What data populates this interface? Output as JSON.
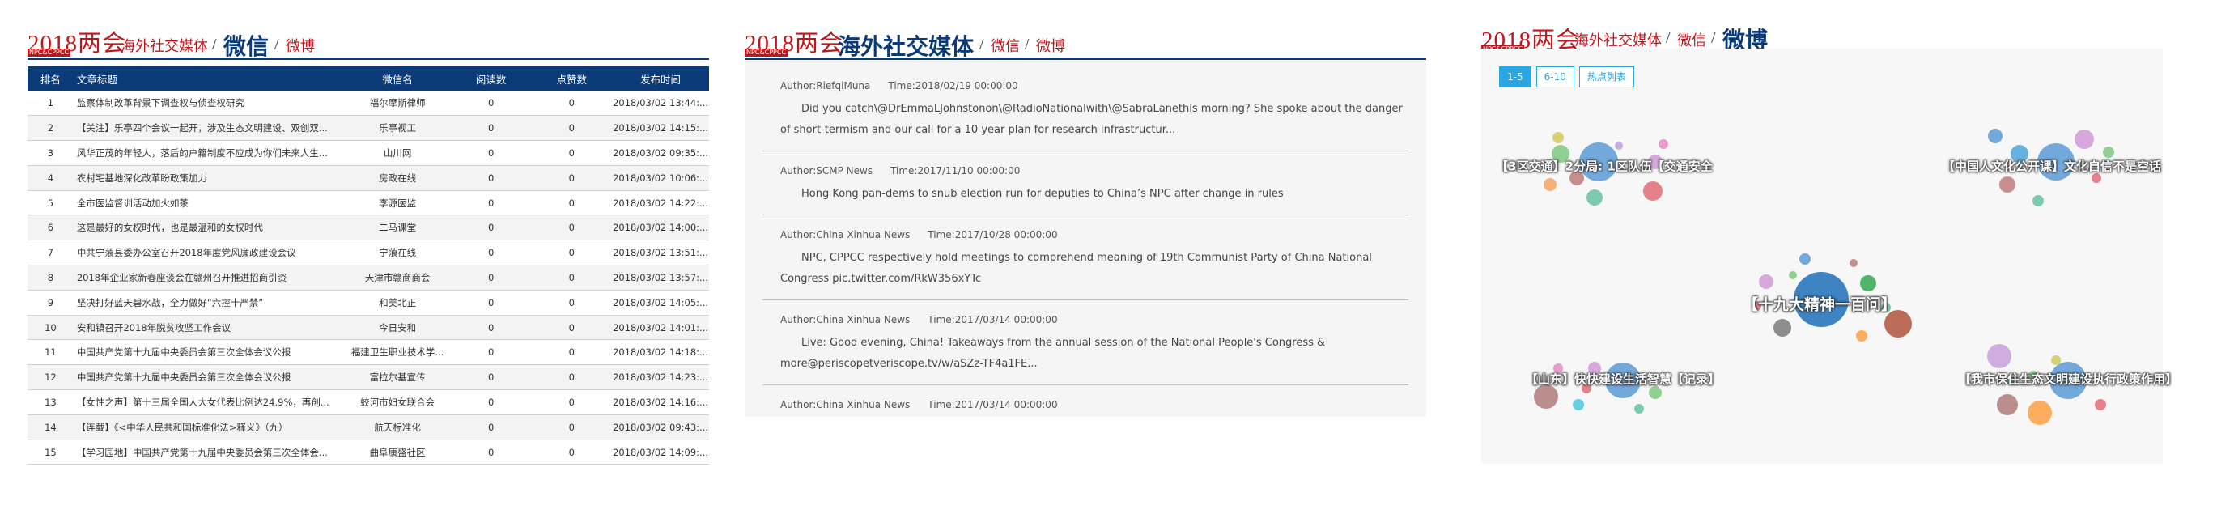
{
  "header": {
    "year": "2018两会",
    "sub": "NPC&CPPCC",
    "title1": "海外社交媒体",
    "sep": "/",
    "wechat": "微信",
    "weibo": "微博"
  },
  "wechat_table": {
    "columns": [
      "排名",
      "文章标题",
      "微信名",
      "阅读数",
      "点赞数",
      "发布时间"
    ],
    "rows": [
      {
        "rank": "1",
        "title": "监察体制改革背景下调查权与侦查权研究",
        "name": "福尔摩斯律师",
        "reads": "0",
        "likes": "0",
        "time": "2018/03/02 13:44:..."
      },
      {
        "rank": "2",
        "title": "【关注】乐亭四个会议一起开，涉及生态文明建设、双创双...",
        "name": "乐亭视工",
        "reads": "0",
        "likes": "0",
        "time": "2018/03/02 14:15:..."
      },
      {
        "rank": "3",
        "title": "风华正茂的年轻人，落后的户籍制度不应成为你们未来人生...",
        "name": "山川网",
        "reads": "0",
        "likes": "0",
        "time": "2018/03/02 09:35:..."
      },
      {
        "rank": "4",
        "title": "农村宅基地深化改革盼政策加力",
        "name": "房政在线",
        "reads": "0",
        "likes": "0",
        "time": "2018/03/02 10:06:..."
      },
      {
        "rank": "5",
        "title": "全市医监督训活动加火如茶",
        "name": "李源医监",
        "reads": "0",
        "likes": "0",
        "time": "2018/03/02 14:22:..."
      },
      {
        "rank": "6",
        "title": "这是最好的女权时代，也是最温和的女权时代",
        "name": "二马课堂",
        "reads": "0",
        "likes": "0",
        "time": "2018/03/02 14:00:..."
      },
      {
        "rank": "7",
        "title": "中共宁蒗县委办公室召开2018年度党风廉政建设会议",
        "name": "宁蒗在线",
        "reads": "0",
        "likes": "0",
        "time": "2018/03/02 13:51:..."
      },
      {
        "rank": "8",
        "title": "2018年企业家新春座谈会在赣州召开推进招商引资",
        "name": "天津市赣商商会",
        "reads": "0",
        "likes": "0",
        "time": "2018/03/02 13:57:..."
      },
      {
        "rank": "9",
        "title": "坚决打好蓝天碧水战，全力做好“六控十严禁”",
        "name": "和美北正",
        "reads": "0",
        "likes": "0",
        "time": "2018/03/02 14:05:..."
      },
      {
        "rank": "10",
        "title": "安和镇召开2018年脱贫攻坚工作会议",
        "name": "今日安和",
        "reads": "0",
        "likes": "0",
        "time": "2018/03/02 14:01:..."
      },
      {
        "rank": "11",
        "title": "中国共产党第十九届中央委员会第三次全体会议公报",
        "name": "福建卫生职业技术学...",
        "reads": "0",
        "likes": "0",
        "time": "2018/03/02 14:18:..."
      },
      {
        "rank": "12",
        "title": "中国共产党第十九届中央委员会第三次全体会议公报",
        "name": "富拉尔基宣传",
        "reads": "0",
        "likes": "0",
        "time": "2018/03/02 14:23:..."
      },
      {
        "rank": "13",
        "title": "【女性之声】第十三届全国人大女代表比例达24.9%，再创...",
        "name": "蛟河市妇女联合会",
        "reads": "0",
        "likes": "0",
        "time": "2018/03/02 14:16:..."
      },
      {
        "rank": "14",
        "title": "【连载】《<中华人民共和国标准化法>释义》（九）",
        "name": "航天标准化",
        "reads": "0",
        "likes": "0",
        "time": "2018/03/02 09:43:..."
      },
      {
        "rank": "15",
        "title": "【学习园地】中国共产党第十九届中央委员会第三次全体会...",
        "name": "曲阜康盛社区",
        "reads": "0",
        "likes": "0",
        "time": "2018/03/02 14:09:..."
      }
    ]
  },
  "posts": [
    {
      "author": "Author:RiefqiMuna",
      "time": "Time:2018/02/19 00:00:00",
      "text": "Did you catch\\@DrEmmaLJohnstonon\\@RadioNationalwith\\@SabraLanethis morning? She spoke about the danger of short-termism and our call for a 10 year plan for research infrastructur..."
    },
    {
      "author": "Author:SCMP News",
      "time": "Time:2017/11/10 00:00:00",
      "text": "Hong Kong pan-dems to snub election run for deputies to China’s NPC after change in rules"
    },
    {
      "author": "Author:China Xinhua News",
      "time": "Time:2017/10/28 00:00:00",
      "text": "NPC, CPPCC respectively hold meetings to comprehend meaning of 19th Communist Party of China National Congress pic.twitter.com/RkW356xYTc"
    },
    {
      "author": "Author:China Xinhua News",
      "time": "Time:2017/03/14 00:00:00",
      "text": "Live: Good evening, China! Takeaways from the annual session of the National People's Congress & more@periscopetveriscope.tv/w/aSZz-TF4a1FE..."
    },
    {
      "author": "Author:China Xinhua News",
      "time": "Time:2017/03/14 00:00:00",
      "text": ""
    }
  ],
  "weibo": {
    "tabs": [
      "1-5",
      "6-10",
      "热点列表"
    ],
    "labels": [
      "【3区交通】2分局: 1区队伍【交通安全",
      "【中国人文化公开课】文化自信不是空话",
      "【十九大精神一百问】",
      "【山东】快快建设生活智慧【记录】",
      "【我市保住生态文明建设执行政策作用】"
    ],
    "colors": {
      "accent": "#2aa6e0",
      "brand_red": "#c0151b",
      "brand_blue": "#0b3a78"
    }
  }
}
